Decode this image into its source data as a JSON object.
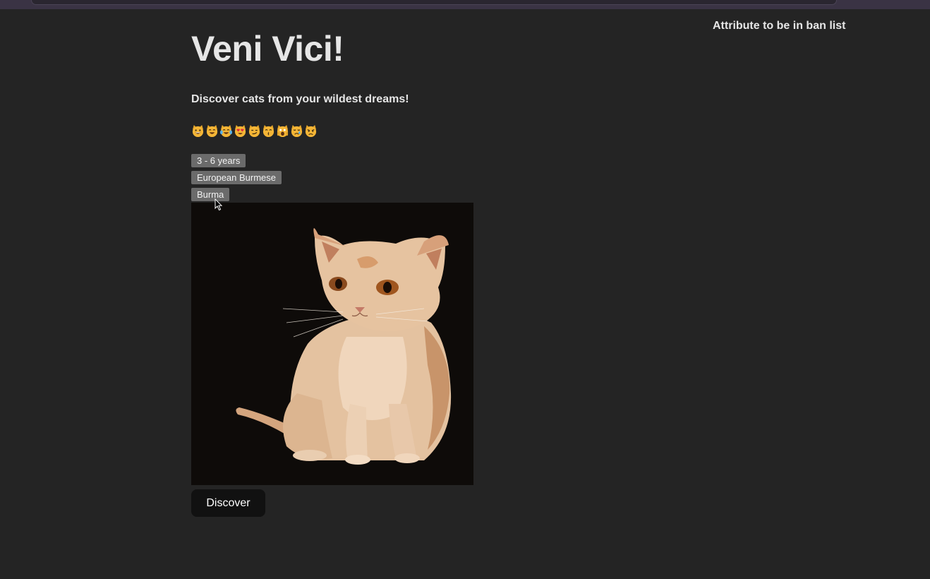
{
  "header": {
    "title": "Veni Vici!",
    "subtitle": "Discover cats from your wildest dreams!",
    "emojis": [
      "grinning-cat-face",
      "smiling-cat-face",
      "cat-tears-of-joy",
      "heart-eyes-cat",
      "smirk-cat",
      "kissing-cat",
      "weary-cat",
      "crying-cat",
      "pouting-cat"
    ]
  },
  "attributes": {
    "life_span": "3 - 6 years",
    "breed": "European Burmese",
    "origin": "Burma"
  },
  "image": {
    "alt": "cat photo",
    "subject": "cream burmese cat sitting"
  },
  "actions": {
    "discover_label": "Discover"
  },
  "ban_list": {
    "title": "Attribute to be in ban list",
    "items": []
  },
  "colors": {
    "background": "#242424",
    "tag_bg": "#6b6b6b",
    "button_bg": "#111111",
    "image_bg": "#0e0b09"
  }
}
